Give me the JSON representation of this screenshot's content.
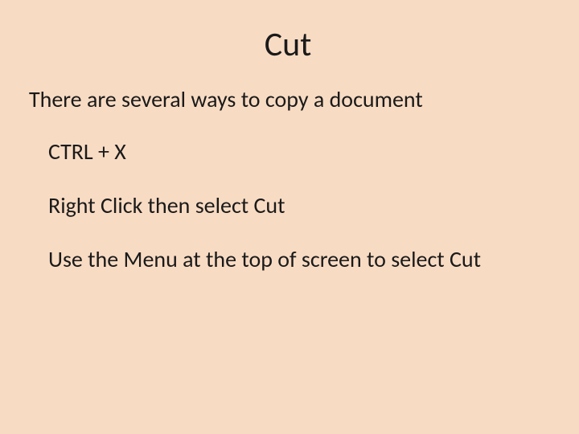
{
  "slide": {
    "title": "Cut",
    "subtitle": "There are several ways to copy a document",
    "items": [
      "CTRL + X",
      "Right Click then select Cut",
      "Use the Menu at the top of screen to select Cut"
    ]
  }
}
